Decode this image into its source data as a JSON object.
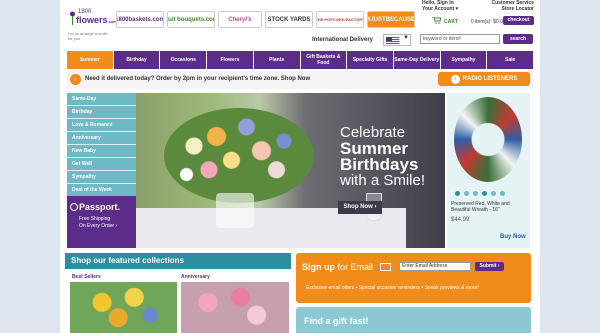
{
  "header": {
    "logo": {
      "number": "1800",
      "name": "flowers",
      "suffix": ".com",
      "tagline": "Let us arrange a smile for you"
    },
    "brands": [
      "1800baskets.com",
      "fruit bouquets.com",
      "Cheryl's",
      "STOCK YARDS",
      "THE POPCORN FACTORY",
      "#JUSTBECAUSE"
    ],
    "account": {
      "line1": "Hello, Sign In",
      "line2": "Your Account ▾"
    },
    "service": {
      "line1": "Customer Service",
      "line2": "Store Locator"
    },
    "cart": {
      "label": "CART",
      "summary": "0 item(s): $0.00"
    },
    "checkout_label": "checkout",
    "intl_label": "International Delivery",
    "search_placeholder": "keyword or item#",
    "search_label": "search"
  },
  "nav": [
    "Summer",
    "Birthday",
    "Occasions",
    "Flowers",
    "Plants",
    "Gift Baskets & Food",
    "Specialty Gifts",
    "Same-Day Delivery",
    "Sympathy",
    "Sale"
  ],
  "promo": {
    "text": "Need it delivered today? Order by 2pm in your recipient's time zone. Shop Now",
    "radio": "RADIO LISTENERS"
  },
  "sidebar": [
    "Same-Day",
    "Birthday",
    "Love & Romance",
    "Anniversary",
    "New Baby",
    "Get Well",
    "Sympathy",
    "Deal of the Week"
  ],
  "passport": {
    "title": "Passport.",
    "line1": "Free Shipping",
    "line2": "On Every Order ›"
  },
  "hero": {
    "line1": "Celebrate",
    "line2": "Summer Birthdays",
    "line3": "with a Smile!",
    "cta": "Shop Now ›"
  },
  "side_promo": {
    "title": "Preserved Red, White and Beautiful Wreath - 16\"",
    "price": "$44.99",
    "cta": "Buy Now"
  },
  "featured": {
    "title": "Shop our featured collections",
    "col1": "Best Sellers",
    "col2": "Anniversary"
  },
  "signup": {
    "title_bold": "Sign up",
    "title_rest": " for Email",
    "email_placeholder": "Enter Email Address",
    "submit": "Submit ›",
    "desc": "Exclusive email offers • Special occasion reminders • Sneak previews & more!"
  },
  "gift": {
    "title": "Find a gift fast!"
  }
}
